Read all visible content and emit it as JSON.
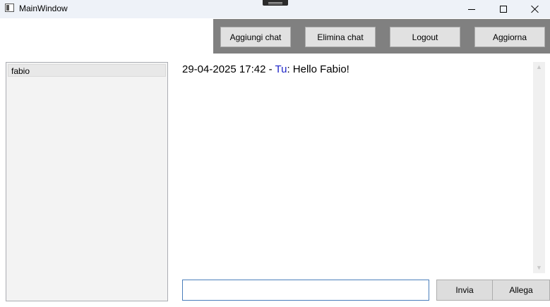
{
  "window": {
    "title": "MainWindow",
    "icon": "app-window-icon",
    "controls": {
      "minimize": "minimize-icon",
      "maximize": "maximize-icon",
      "close": "close-icon"
    }
  },
  "toolbar": {
    "add_chat": "Aggiungi chat",
    "delete_chat": "Elimina chat",
    "logout": "Logout",
    "refresh": "Aggiorna"
  },
  "chats": [
    {
      "label": "fabio"
    }
  ],
  "messages": [
    {
      "timestamp": "29-04-2025 17:42",
      "separator": " - ",
      "sender": "Tu",
      "colon": ": ",
      "text": "Hello Fabio!"
    }
  ],
  "composer": {
    "value": "",
    "send_label": "Invia",
    "attach_label": "Allega"
  },
  "colors": {
    "toolbar_bg": "#808080",
    "sender_color": "#1d24c8",
    "input_border": "#4a7ebb"
  }
}
